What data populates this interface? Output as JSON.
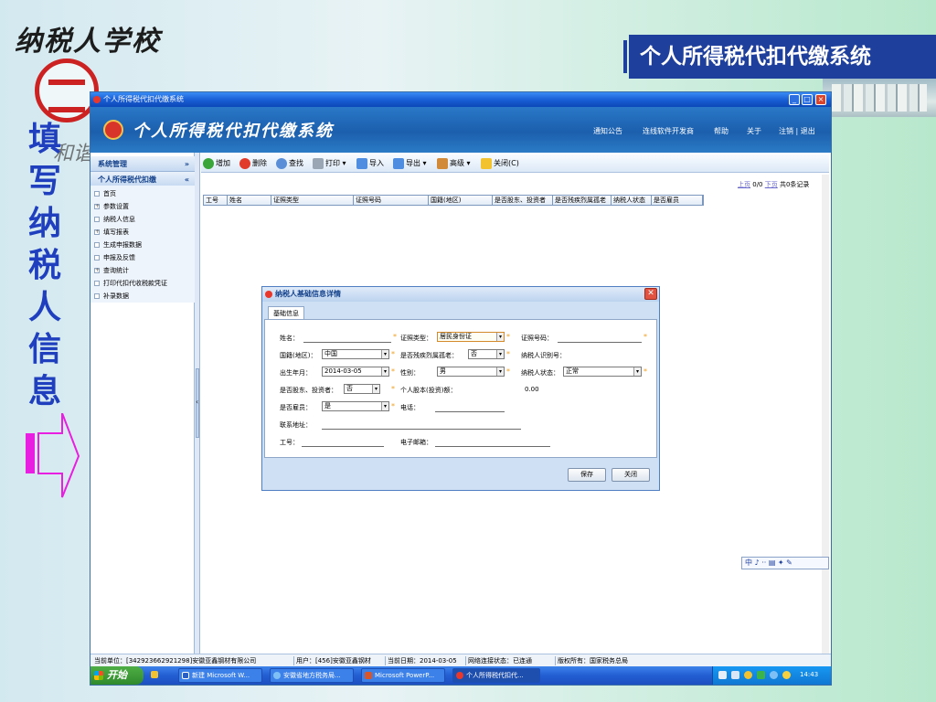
{
  "slide": {
    "school_title": "纳税人学校",
    "banner_title": "个人所得税代扣代缴系统",
    "vertical_caption": "填写纳税人信息",
    "watermark": "和谐"
  },
  "window": {
    "title": "个人所得税代扣代缴系统",
    "controls": [
      "_",
      "□",
      "×"
    ]
  },
  "header": {
    "app_title": "个人所得税代扣代缴系统",
    "links": [
      "通知公告",
      "连线软件开发商",
      "帮助",
      "关于",
      "注销 | 退出"
    ]
  },
  "sidebar": {
    "panel1": "系统管理",
    "panel2": "个人所得税代扣缴",
    "items": [
      {
        "label": "首页",
        "expandable": false
      },
      {
        "label": "参数设置",
        "expandable": true
      },
      {
        "label": "纳税人信息",
        "expandable": false
      },
      {
        "label": "填写报表",
        "expandable": true
      },
      {
        "label": "生成申报数据",
        "expandable": false
      },
      {
        "label": "申报及反馈",
        "expandable": false
      },
      {
        "label": "查询统计",
        "expandable": true
      },
      {
        "label": "打印代扣代收税款凭证",
        "expandable": false
      },
      {
        "label": "补录数据",
        "expandable": false
      }
    ]
  },
  "toolbar": {
    "add": "增加",
    "delete": "删除",
    "find": "查找",
    "print": "打印",
    "import": "导入",
    "export": "导出",
    "advanced": "高级",
    "close": "关闭(C)"
  },
  "pager": {
    "prev": "上页",
    "count": "0/0",
    "next": "下页",
    "total": "共0条记录"
  },
  "grid": {
    "columns": [
      "工号",
      "姓名",
      "证照类型",
      "证照号码",
      "国籍(地区)",
      "是否股东、投资者",
      "是否残疾烈属孤老",
      "纳税人状态",
      "是否雇员"
    ]
  },
  "dialog": {
    "title": "纳税人基础信息详情",
    "tab": "基础信息",
    "labels": {
      "name": "姓名：",
      "id_type": "证照类型：",
      "id_no": "证照号码：",
      "nationality": "国籍(地区)：",
      "disabled": "是否残疾烈属孤老：",
      "taxpayer_id": "纳税人识别号：",
      "birth": "出生年月：",
      "gender": "性别：",
      "status": "纳税人状态：",
      "shareholder": "是否股东、投资者：",
      "capital": "个人股本(投资)额：",
      "employee": "是否雇员：",
      "phone": "电话：",
      "address": "联系地址：",
      "job_no": "工号：",
      "email": "电子邮箱："
    },
    "values": {
      "id_type": "居民身份证",
      "nationality": "中国",
      "disabled": "否",
      "birth": "2014-03-05",
      "gender": "男",
      "status": "正常",
      "shareholder": "否",
      "capital": "0.00",
      "employee": "是"
    },
    "save": "保存",
    "close": "关闭"
  },
  "ime": "中 ♪ ·· ▤ ✦ ✎",
  "status": {
    "unit": "当前单位：[342923662921298]安徽亚鑫钢材有限公司",
    "user": "用户：[456]安徽亚鑫钢材",
    "date": "当前日期：2014-03-05",
    "net": "网络连接状态：已连通",
    "copyright": "版权所有：国家税务总局"
  },
  "taskbar": {
    "start": "开始",
    "tasks": [
      "新建 Microsoft W...",
      "安徽省地方税务局...",
      "Microsoft PowerP...",
      "个人所得税代扣代..."
    ],
    "clock": "14:43"
  },
  "colors": {
    "banner": "#1f3f9c",
    "caption": "#1f3fbf",
    "arrow": "#e81ee0",
    "app_header": "#1b5fad",
    "required": "#f0a020"
  }
}
